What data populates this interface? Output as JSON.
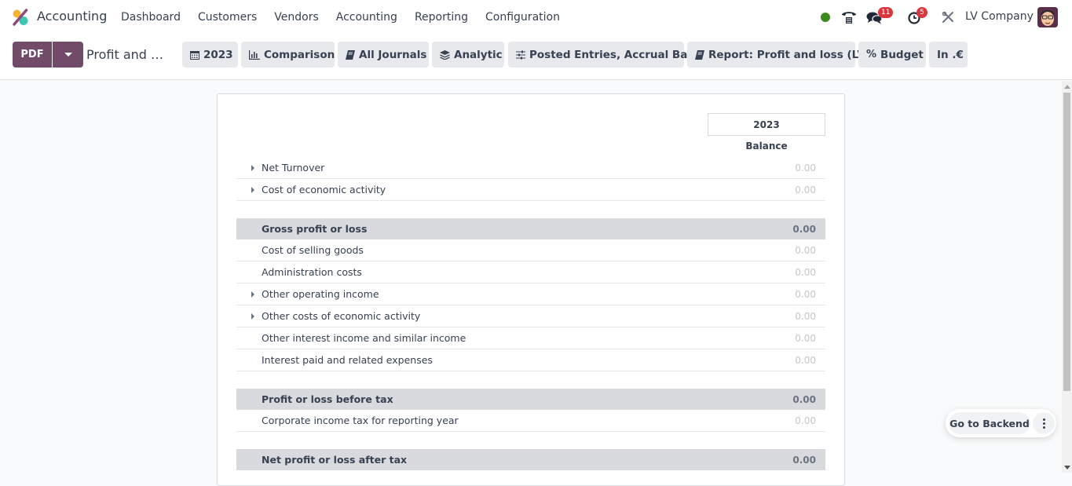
{
  "navbar": {
    "app_name": "Accounting",
    "menu": [
      "Dashboard",
      "Customers",
      "Vendors",
      "Accounting",
      "Reporting",
      "Configuration"
    ],
    "status_color": "#3d8b1f",
    "messages_count": "11",
    "activities_count": "5",
    "company": "LV Company",
    "icons": {
      "status": "online-status-dot",
      "phone": "phone-icon",
      "messages": "chat-icon",
      "activities": "clock-icon",
      "debug": "tools-icon"
    }
  },
  "controlbar": {
    "pdf_label": "PDF",
    "report_title": "Profit and …",
    "filters": [
      {
        "icon": "calendar-icon",
        "label": "2023"
      },
      {
        "icon": "bar-chart-icon",
        "label": "Comparison"
      },
      {
        "icon": "book-icon",
        "label": "All Journals"
      },
      {
        "icon": "layers-icon",
        "label": "Analytic"
      },
      {
        "icon": "sliders-icon",
        "label": "Posted Entries, Accrual Basis"
      },
      {
        "icon": "book-icon",
        "label": "Report: Profit and loss (LV)"
      },
      {
        "icon": "percent-icon",
        "label": "Budget"
      },
      {
        "icon": "",
        "label": "In .€"
      }
    ]
  },
  "report": {
    "column_header": "2023",
    "column_subheader": "Balance",
    "rows": [
      {
        "label": "Net Turnover",
        "value": "0.00",
        "type": "line",
        "expandable": true
      },
      {
        "label": "Cost of economic activity",
        "value": "0.00",
        "type": "line",
        "expandable": true
      },
      {
        "label": "Gross profit or loss",
        "value": "0.00",
        "type": "total",
        "expandable": false
      },
      {
        "label": "Cost of selling goods",
        "value": "0.00",
        "type": "line",
        "expandable": false
      },
      {
        "label": "Administration costs",
        "value": "0.00",
        "type": "line",
        "expandable": false
      },
      {
        "label": "Other operating income",
        "value": "0.00",
        "type": "line",
        "expandable": true
      },
      {
        "label": "Other costs of economic activity",
        "value": "0.00",
        "type": "line",
        "expandable": true
      },
      {
        "label": "Other interest income and similar income",
        "value": "0.00",
        "type": "line",
        "expandable": false
      },
      {
        "label": "Interest paid and related expenses",
        "value": "0.00",
        "type": "line",
        "expandable": false
      },
      {
        "label": "Profit or loss before tax",
        "value": "0.00",
        "type": "total",
        "expandable": false
      },
      {
        "label": "Corporate income tax for reporting year",
        "value": "0.00",
        "type": "line",
        "expandable": false
      },
      {
        "label": "Net profit or loss after tax",
        "value": "0.00",
        "type": "total",
        "expandable": false
      }
    ]
  },
  "floating": {
    "go_backend_label": "Go to Backend"
  }
}
